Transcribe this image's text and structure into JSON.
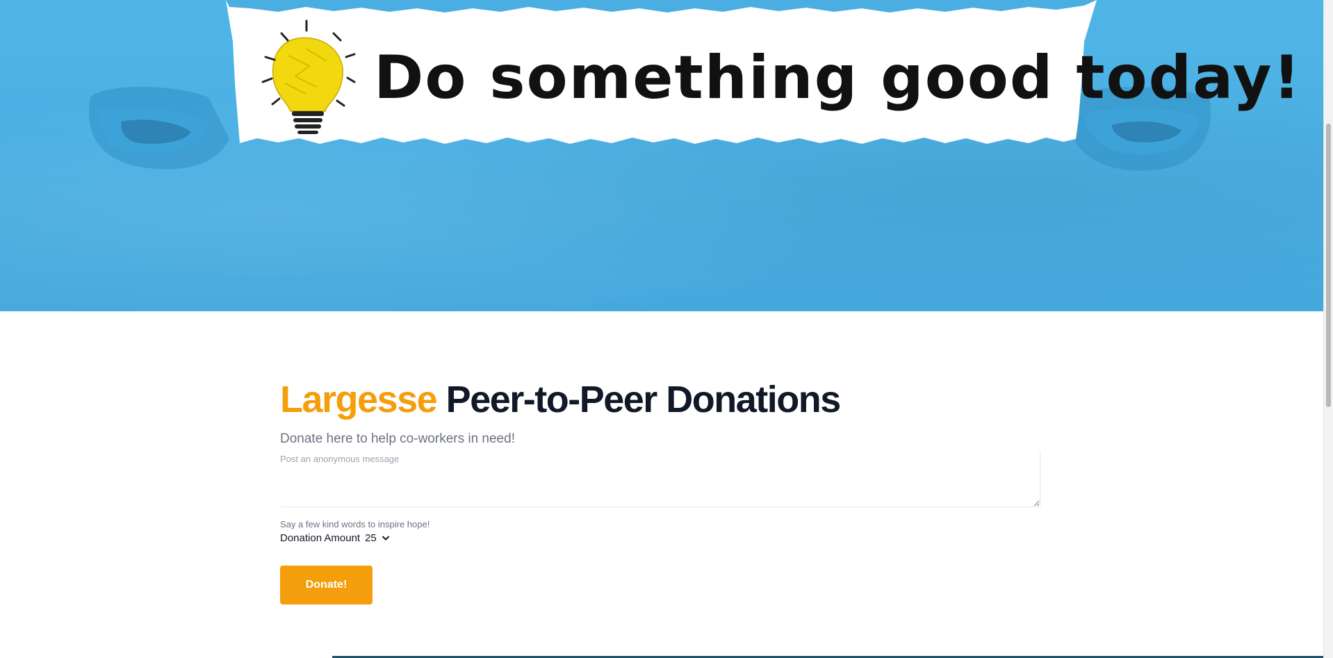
{
  "hero": {
    "banner_text": "Do something good today!"
  },
  "main": {
    "title_brand": "Largesse",
    "title_rest": "Peer-to-Peer Donations",
    "subtitle": "Donate here to help co-workers in need!",
    "message_placeholder": "Post an anonymous message",
    "message_hint": "Say a few kind words to inspire hope!",
    "amount_label": "Donation Amount",
    "amount_value": "25",
    "donate_label": "Donate!"
  },
  "colors": {
    "accent": "#f59e0b",
    "banner_blue": "#4aaee2",
    "title_dark": "#111827"
  }
}
